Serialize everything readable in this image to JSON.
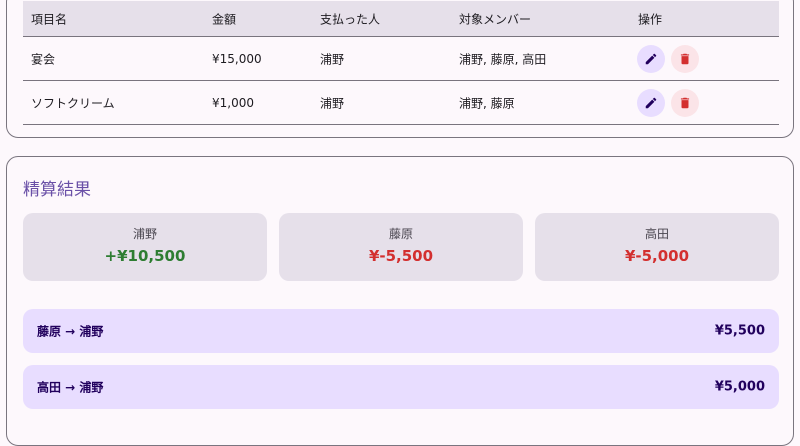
{
  "expenses": {
    "headers": {
      "item": "項目名",
      "amount": "金額",
      "payer": "支払った人",
      "members": "対象メンバー",
      "actions": "操作"
    },
    "rows": [
      {
        "item": "宴会",
        "amount": "¥15,000",
        "payer": "浦野",
        "members": "浦野, 藤原, 高田"
      },
      {
        "item": "ソフトクリーム",
        "amount": "¥1,000",
        "payer": "浦野",
        "members": "浦野, 藤原"
      }
    ],
    "edit_icon": "pencil-icon",
    "delete_icon": "trash-icon"
  },
  "settlement": {
    "title": "精算結果",
    "balances": [
      {
        "name": "浦野",
        "amount": "+¥10,500",
        "status": "positive"
      },
      {
        "name": "藤原",
        "amount": "¥-5,500",
        "status": "negative"
      },
      {
        "name": "高田",
        "amount": "¥-5,000",
        "status": "negative"
      }
    ],
    "transfers": [
      {
        "route": "藤原 → 浦野",
        "amount": "¥5,500"
      },
      {
        "route": "高田 → 浦野",
        "amount": "¥5,000"
      }
    ]
  },
  "colors": {
    "accent": "#6a50a7",
    "positive": "#2e7d32",
    "negative": "#d32f2f",
    "edit_bg": "#e8ddff",
    "delete_bg": "#fbe4e8"
  }
}
